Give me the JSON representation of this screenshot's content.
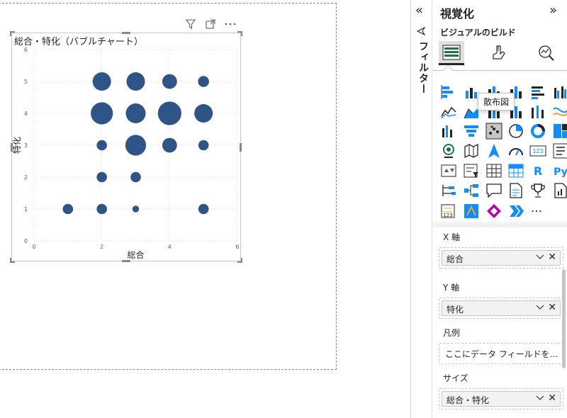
{
  "visual": {
    "title": "総合・特化（バブルチャート）",
    "header_icons": [
      "filter-icon",
      "focus-mode-icon",
      "more-options-icon"
    ]
  },
  "chart_data": {
    "type": "scatter",
    "title": "総合・特化（バブルチャート）",
    "xlabel": "総合",
    "ylabel": "特化",
    "xlim": [
      0,
      6
    ],
    "ylim": [
      0,
      6
    ],
    "x_ticks": [
      "0",
      "2",
      "4",
      "6"
    ],
    "y_ticks": [
      "0",
      "1",
      "2",
      "3",
      "4",
      "5",
      "6"
    ],
    "grid": true,
    "color": "#2f5486",
    "series": [
      {
        "points": [
          {
            "x": 2,
            "y": 5,
            "size": 2.5
          },
          {
            "x": 3,
            "y": 5,
            "size": 2.5
          },
          {
            "x": 4,
            "y": 5,
            "size": 2
          },
          {
            "x": 5,
            "y": 5,
            "size": 1.5
          },
          {
            "x": 2,
            "y": 4,
            "size": 3
          },
          {
            "x": 3,
            "y": 4,
            "size": 2.7
          },
          {
            "x": 4,
            "y": 4,
            "size": 3.2
          },
          {
            "x": 5,
            "y": 4,
            "size": 2.5
          },
          {
            "x": 2,
            "y": 3,
            "size": 1.4
          },
          {
            "x": 3,
            "y": 3,
            "size": 2.8
          },
          {
            "x": 4,
            "y": 3,
            "size": 2
          },
          {
            "x": 5,
            "y": 3,
            "size": 1.4
          },
          {
            "x": 2,
            "y": 2,
            "size": 1.4
          },
          {
            "x": 3,
            "y": 2,
            "size": 1.4
          },
          {
            "x": 1,
            "y": 1,
            "size": 1.4
          },
          {
            "x": 2,
            "y": 1,
            "size": 1.4
          },
          {
            "x": 3,
            "y": 1,
            "size": 0.9
          },
          {
            "x": 5,
            "y": 1,
            "size": 1.4
          }
        ]
      }
    ]
  },
  "filter_rail": {
    "label": "フィルター",
    "collapse_icon": "double-chevron-left-icon"
  },
  "viz_pane": {
    "title": "視覚化",
    "expand_icon": "double-chevron-right-icon",
    "subtitle": "ビジュアルのビルド",
    "tooltip": "散布図",
    "more_label": "…",
    "visual_icons_r_label": "R",
    "visual_icons_py_label": "Py",
    "visual_icons_123_label": "123"
  },
  "wells": {
    "x_axis": {
      "label": "X 軸",
      "value": "総合"
    },
    "y_axis": {
      "label": "Y 軸",
      "value": "特化"
    },
    "legend": {
      "label": "凡例",
      "placeholder": "ここにデータ フィールドを..."
    },
    "size": {
      "label": "サイズ",
      "value": "総合・特化"
    }
  },
  "colors": {
    "bubble": "#2f5486",
    "accent": "#118dff"
  }
}
